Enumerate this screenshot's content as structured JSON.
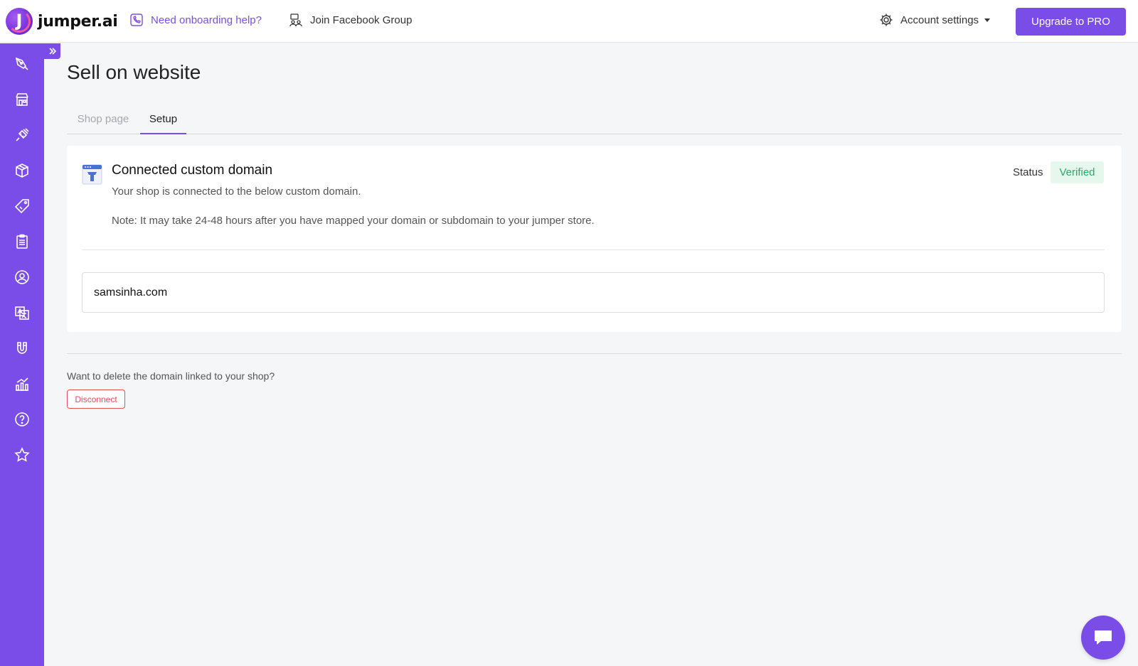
{
  "app": {
    "brand": "jumper.ai",
    "brand_initial": "J"
  },
  "header": {
    "help_link": "Need onboarding help?",
    "facebook_link": "Join Facebook Group",
    "account_label": "Account settings",
    "upgrade_button": "Upgrade to PRO"
  },
  "sidebar": {
    "items": [
      {
        "icon": "pen-tool-icon"
      },
      {
        "icon": "store-icon"
      },
      {
        "icon": "plug-icon"
      },
      {
        "icon": "box-icon"
      },
      {
        "icon": "tag-icon"
      },
      {
        "icon": "clipboard-list-icon"
      },
      {
        "icon": "user-circle-icon"
      },
      {
        "icon": "translate-icon"
      },
      {
        "icon": "magnet-icon"
      },
      {
        "icon": "analytics-icon"
      },
      {
        "icon": "help-icon"
      },
      {
        "icon": "star-icon"
      }
    ]
  },
  "page": {
    "title": "Sell on website",
    "tabs": [
      {
        "label": "Shop page",
        "active": false
      },
      {
        "label": "Setup",
        "active": true
      }
    ]
  },
  "domain_card": {
    "title": "Connected custom domain",
    "description": "Your shop is connected to the below custom domain.",
    "note": "Note: It may take 24-48 hours after you have mapped your domain or subdomain to your jumper store.",
    "status_label": "Status",
    "status_value": "Verified",
    "domain_value": "samsinha.com"
  },
  "delete_section": {
    "prompt": "Want to delete the domain linked to your shop?",
    "button": "Disconnect"
  },
  "colors": {
    "accent": "#7a4ce8",
    "success": "#2fa866",
    "danger": "#e84a5f"
  }
}
